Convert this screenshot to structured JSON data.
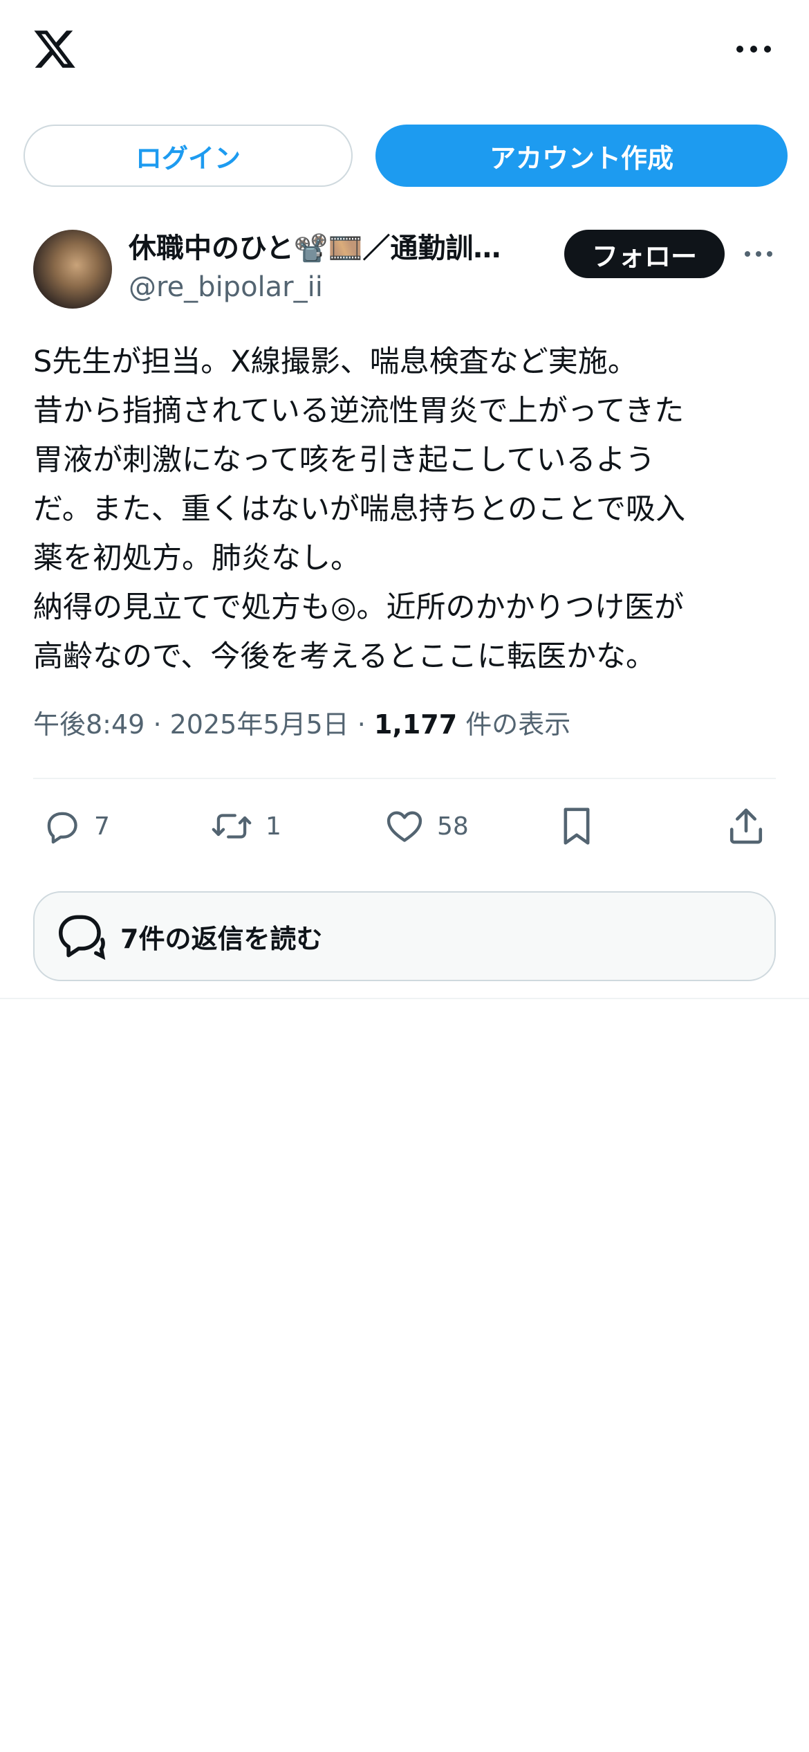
{
  "header": {
    "logo_icon": "x-logo-icon",
    "more_icon": "more-horizontal-icon"
  },
  "auth": {
    "login_label": "ログイン",
    "signup_label": "アカウント作成"
  },
  "post": {
    "author_name": "休職中のひと📽️🎞️／通勤訓…",
    "handle": "@re_bipolar_ii",
    "follow_label": "フォロー",
    "body_lines": [
      "S先生が担当。X線撮影、喘息検査など実施。",
      "昔から指摘されている逆流性胃炎で上がってきた",
      "胃液が刺激になって咳を引き起こしているよう",
      "だ。また、重くはないが喘息持ちとのことで吸入",
      "薬を初処方。肺炎なし。",
      "納得の見立てで処方も◎。近所のかかりつけ医が",
      "高齢なので、今後を考えるとここに転医かな。"
    ],
    "time": "午後8:49",
    "date": "2025年5月5日",
    "views_count": "1,177",
    "views_label": "件の表示"
  },
  "actions": {
    "reply_count": "7",
    "retweet_count": "1",
    "like_count": "58"
  },
  "replies": {
    "label": "7件の返信を読む"
  },
  "colors": {
    "accent": "#1d9bf0",
    "text": "#0f1419",
    "muted": "#536471",
    "border": "#cfd9de"
  }
}
